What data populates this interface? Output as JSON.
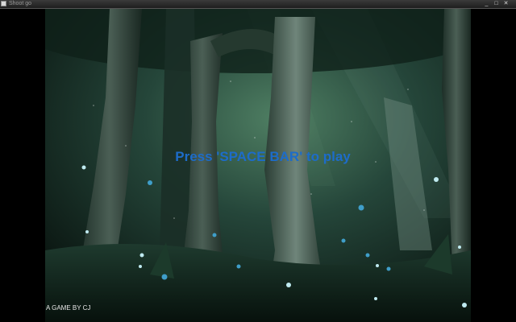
{
  "window": {
    "title": "Shoot go",
    "minimize_glyph": "_",
    "maximize_glyph": "□",
    "close_glyph": "✕"
  },
  "game": {
    "prompt": "Press 'SPACE BAR' to play",
    "credit": "A GAME BY CJ",
    "prompt_color": "#1d6cc9",
    "background_scene": "enchanted forest with glowing butterflies"
  }
}
